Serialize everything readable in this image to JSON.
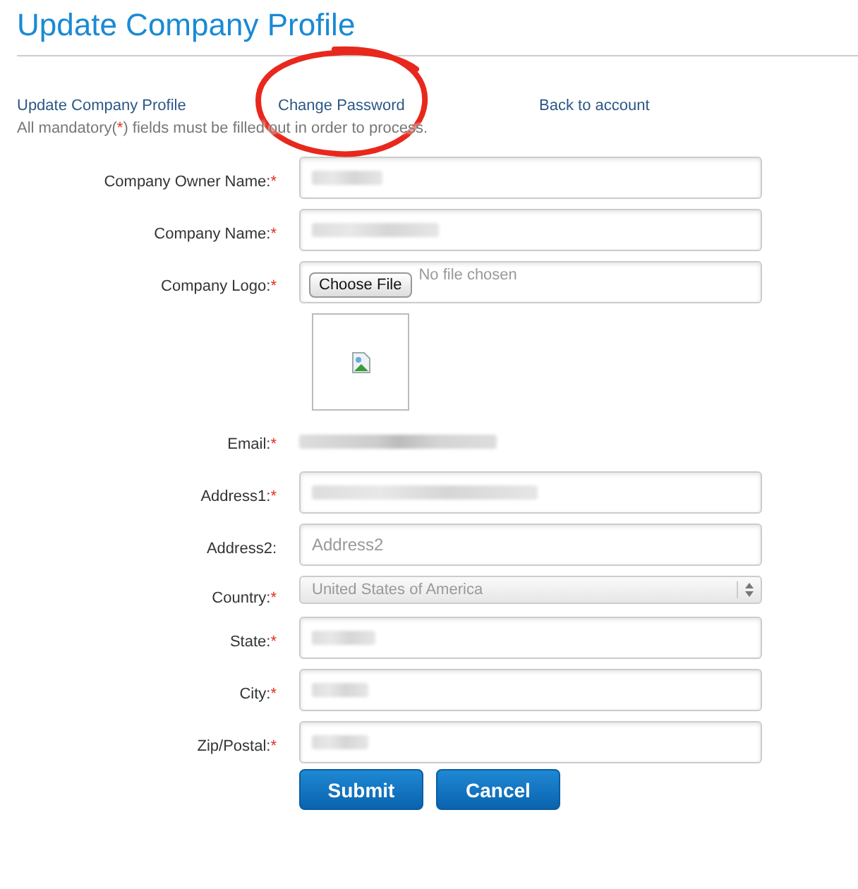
{
  "title": "Update Company Profile",
  "links": [
    {
      "label": "Update Company Profile",
      "circled": false
    },
    {
      "label": "Change Password",
      "circled": true
    },
    {
      "label": "Back to account",
      "circled": false
    }
  ],
  "notice": {
    "before": "All mandatory(",
    "mark": "*",
    "after": ") fields must be filled out in order to process."
  },
  "fields": [
    {
      "kind": "text",
      "label": "Company Owner Name:",
      "required": true,
      "blurred": true
    },
    {
      "kind": "text",
      "label": "Company Name:",
      "required": true,
      "blurred": true
    },
    {
      "kind": "file",
      "label": "Company Logo:",
      "required": true,
      "button": "Choose File",
      "status": "No file chosen"
    },
    {
      "kind": "image"
    },
    {
      "kind": "static",
      "label": "Email:",
      "required": true,
      "blurred": true
    },
    {
      "kind": "text",
      "label": "Address1:",
      "required": true,
      "blurred": true
    },
    {
      "kind": "text",
      "label": "Address2:",
      "required": false,
      "placeholder": "Address2"
    },
    {
      "kind": "select",
      "label": "Country:",
      "required": true,
      "value": "United States of America",
      "disabled": true
    },
    {
      "kind": "text",
      "label": "State:",
      "required": true,
      "blurred": true
    },
    {
      "kind": "text",
      "label": "City:",
      "required": true,
      "blurred": true
    },
    {
      "kind": "text",
      "label": "Zip/Postal:",
      "required": true,
      "blurred": true
    }
  ],
  "buttons": [
    "Submit",
    "Cancel"
  ]
}
